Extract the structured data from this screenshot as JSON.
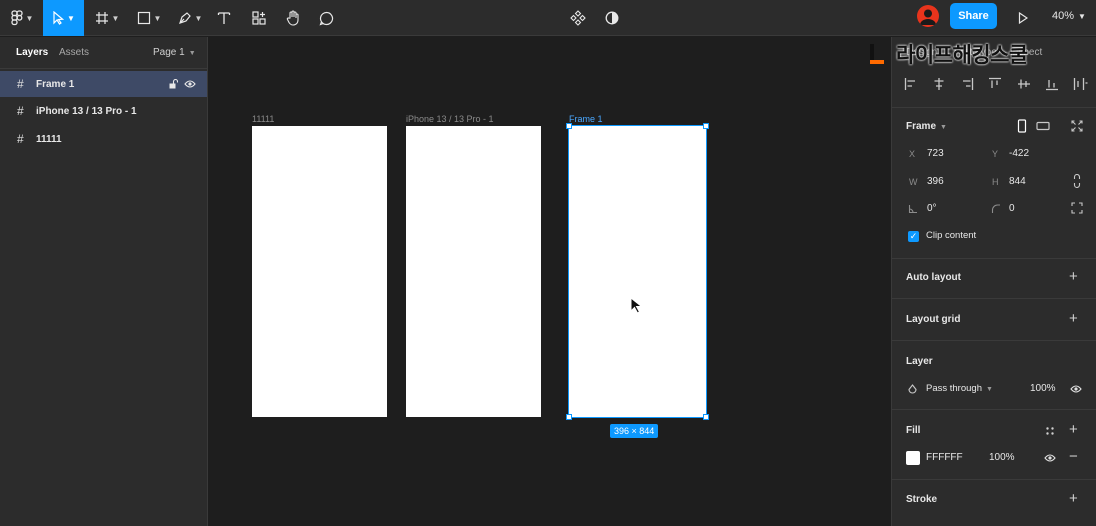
{
  "toolbar": {
    "share_label": "Share",
    "zoom_label": "40%",
    "tools": [
      "figma-menu-icon",
      "move-tool-icon",
      "frame-tool-icon",
      "shape-tool-icon",
      "pen-tool-icon",
      "text-tool-icon",
      "resources-icon",
      "hand-tool-icon",
      "comment-tool-icon"
    ],
    "center_tools": [
      "components-icon",
      "mask-icon"
    ],
    "accent": "#0d99ff"
  },
  "left_panel": {
    "tabs": {
      "layers": "Layers",
      "assets": "Assets"
    },
    "page": "Page 1",
    "layers": [
      {
        "name": "Frame 1",
        "selected": true
      },
      {
        "name": "iPhone 13 / 13 Pro - 1",
        "selected": false
      },
      {
        "name": "11111",
        "selected": false
      }
    ]
  },
  "canvas": {
    "frames": [
      {
        "label": "11111"
      },
      {
        "label": "iPhone 13 / 13 Pro - 1"
      },
      {
        "label": "Frame 1",
        "selected": true
      }
    ],
    "size_badge": "396 × 844"
  },
  "watermark": {
    "text": "라이프해킹스쿨"
  },
  "right_panel": {
    "tabs": [
      "Design",
      "Prototype",
      "Inspect"
    ],
    "frame": {
      "title": "Frame",
      "x_label": "X",
      "x": "723",
      "y_label": "Y",
      "y": "-422",
      "w_label": "W",
      "w": "396",
      "h_label": "H",
      "h": "844",
      "rotation": "0°",
      "radius": "0",
      "clip_label": "Clip content"
    },
    "auto_layout": "Auto layout",
    "layout_grid": "Layout grid",
    "layer": {
      "title": "Layer",
      "blend": "Pass through",
      "opacity": "100%"
    },
    "fill": {
      "title": "Fill",
      "hex": "FFFFFF",
      "opacity": "100%"
    },
    "stroke": {
      "title": "Stroke"
    }
  }
}
